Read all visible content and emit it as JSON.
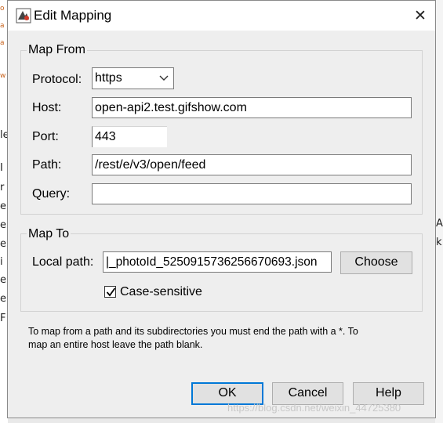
{
  "dialog": {
    "title": "Edit Mapping",
    "close_glyph": "✕",
    "icon": "app-logo-icon"
  },
  "map_from": {
    "legend": "Map From",
    "protocol_label": "Protocol:",
    "protocol_value": "https",
    "host_label": "Host:",
    "host_value": "open-api2.test.gifshow.com",
    "port_label": "Port:",
    "port_value": "443",
    "path_label": "Path:",
    "path_value": "/rest/e/v3/open/feed",
    "query_label": "Query:",
    "query_value": ""
  },
  "map_to": {
    "legend": "Map To",
    "local_path_label": "Local path:",
    "local_path_value": "|_photoId_5250915736256670693.json",
    "choose_label": "Choose",
    "case_sensitive_label": "Case-sensitive",
    "case_sensitive_checked": true
  },
  "help_text": {
    "line1": "To map from a path and its subdirectories you must end the path with a *. To",
    "line2": "map an entire host leave the path blank."
  },
  "buttons": {
    "ok": "OK",
    "cancel": "Cancel",
    "help": "Help"
  },
  "watermark": "https://blog.csdn.net/weixin_44725380",
  "background": {
    "left_fragments": [
      "o",
      "a",
      "a",
      "w",
      "le",
      "I",
      "r",
      "e",
      "e",
      "e",
      "i",
      "e",
      "e",
      "F"
    ],
    "right_fragments": [
      "A",
      "k"
    ]
  },
  "colors": {
    "accent": "#0078d7",
    "dialog_bg": "#eeeeee",
    "titlebar_bg": "#ffffff"
  }
}
